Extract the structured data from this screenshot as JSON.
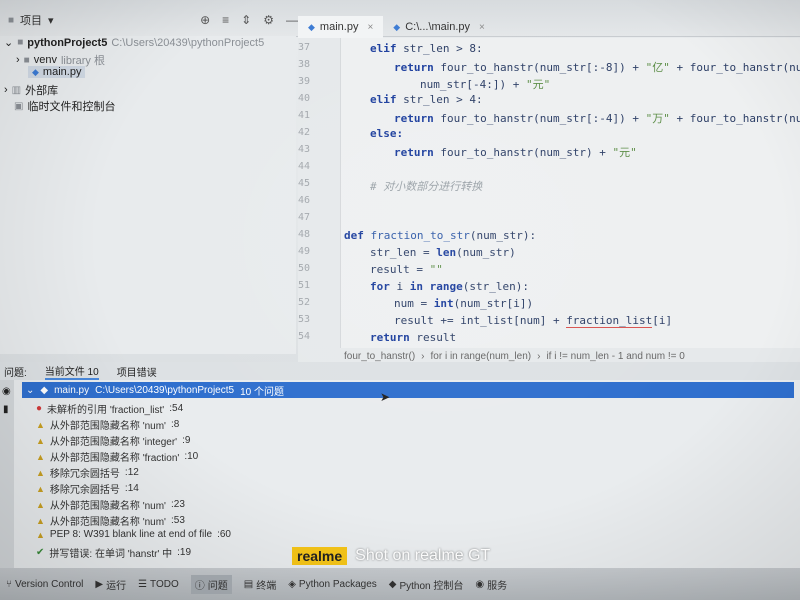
{
  "toolbar": {
    "project_label": "项目",
    "tabs": [
      {
        "label": "main.py"
      },
      {
        "label": "C:\\...\\main.py"
      }
    ]
  },
  "tree": {
    "project_name": "pythonProject5",
    "project_path": "C:\\Users\\20439\\pythonProject5",
    "venv": "venv",
    "venv_note": "library 根",
    "file": "main.py",
    "external_libs": "外部库",
    "scratches": "临时文件和控制台"
  },
  "editor": {
    "line_numbers": [
      "37",
      "38",
      "39",
      "40",
      "41",
      "42",
      "43",
      "44",
      "45",
      "46",
      "47",
      "48",
      "49",
      "50",
      "51",
      "52",
      "53",
      "54"
    ],
    "code": {
      "l37": [
        "elif ",
        "str_len > 8:"
      ],
      "l38": [
        "return ",
        "four_to_hanstr(num_str[:-8]) + ",
        "\"亿\"",
        " + four_to_hanstr(num_str"
      ],
      "l39": [
        "num_str[-4:]) + ",
        "\"元\""
      ],
      "l40": [
        "elif ",
        "str_len > 4:"
      ],
      "l41": [
        "return ",
        "four_to_hanstr(num_str[:-4]) + ",
        "\"万\"",
        " + four_to_hanstr(num_str"
      ],
      "l42": [
        "else:"
      ],
      "l43": [
        "return ",
        "four_to_hanstr(num_str) + ",
        "\"元\""
      ],
      "l45": "# 对小数部分进行转换",
      "l48": [
        "def ",
        "fraction_to_str",
        "(num_str):"
      ],
      "l49": [
        "str_len = ",
        "len",
        "(num_str)"
      ],
      "l50": [
        "result = ",
        "\"\""
      ],
      "l51": [
        "for ",
        "i ",
        "in ",
        "range",
        "(str_len):"
      ],
      "l52": [
        "num = ",
        "int",
        "(num_str[i])"
      ],
      "l53": [
        "result += int_list[num] + ",
        "fraction_list",
        "[i]"
      ],
      "l54": [
        "return ",
        "result"
      ]
    },
    "breadcrumb": [
      "four_to_hanstr()",
      "for i in range(num_len)",
      "if i != num_len - 1 and num != 0"
    ]
  },
  "panel": {
    "tabs": [
      "问题:",
      "当前文件 10",
      "项目错误"
    ],
    "header": {
      "file": "main.py",
      "path": "C:\\Users\\20439\\pythonProject5",
      "count": "10 个问题"
    },
    "problems": [
      {
        "type": "error",
        "text": "未解析的引用 'fraction_list'",
        "line": ":54"
      },
      {
        "type": "warning",
        "text": "从外部范围隐藏名称 'num'",
        "line": ":8"
      },
      {
        "type": "warning",
        "text": "从外部范围隐藏名称 'integer'",
        "line": ":9"
      },
      {
        "type": "warning",
        "text": "从外部范围隐藏名称 'fraction'",
        "line": ":10"
      },
      {
        "type": "warning",
        "text": "移除冗余圆括号",
        "line": ":12"
      },
      {
        "type": "warning",
        "text": "移除冗余圆括号",
        "line": ":14"
      },
      {
        "type": "warning",
        "text": "从外部范围隐藏名称 'num'",
        "line": ":23"
      },
      {
        "type": "warning",
        "text": "从外部范围隐藏名称 'num'",
        "line": ":53"
      },
      {
        "type": "warning",
        "text": "PEP 8: W391 blank line at end of file",
        "line": ":60"
      },
      {
        "type": "spell",
        "text": "拼写错误: 在单词 'hanstr' 中",
        "line": ":19"
      }
    ]
  },
  "statusbar": {
    "items": [
      "Version Control",
      "运行",
      "TODO",
      "问题",
      "终端",
      "Python Packages",
      "Python 控制台",
      "服务"
    ]
  },
  "watermark": {
    "brand": "realme",
    "text": "Shot on realme GT"
  },
  "colors": {
    "selection_blue": "#2f6fce",
    "keyword": "#1d3f9e",
    "string": "#5b8d46",
    "error": "#d23b3b",
    "warning": "#c9a022",
    "watermark_yellow": "#f5c518"
  }
}
